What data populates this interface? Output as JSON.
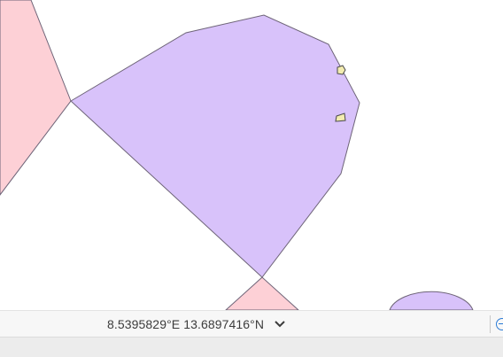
{
  "map": {
    "colors": {
      "pink_fill": "#fdd0d6",
      "purple_fill": "#d8c2fa",
      "outline": "#6e6478",
      "marker_fill": "#f3ecb0",
      "marker_stroke": "#4a4a4a"
    }
  },
  "status_bar": {
    "coordinates": "8.5395829°E 13.6897416°N",
    "toggle_icon": "chevron-down-icon",
    "right_icon": "zoom-icon"
  }
}
